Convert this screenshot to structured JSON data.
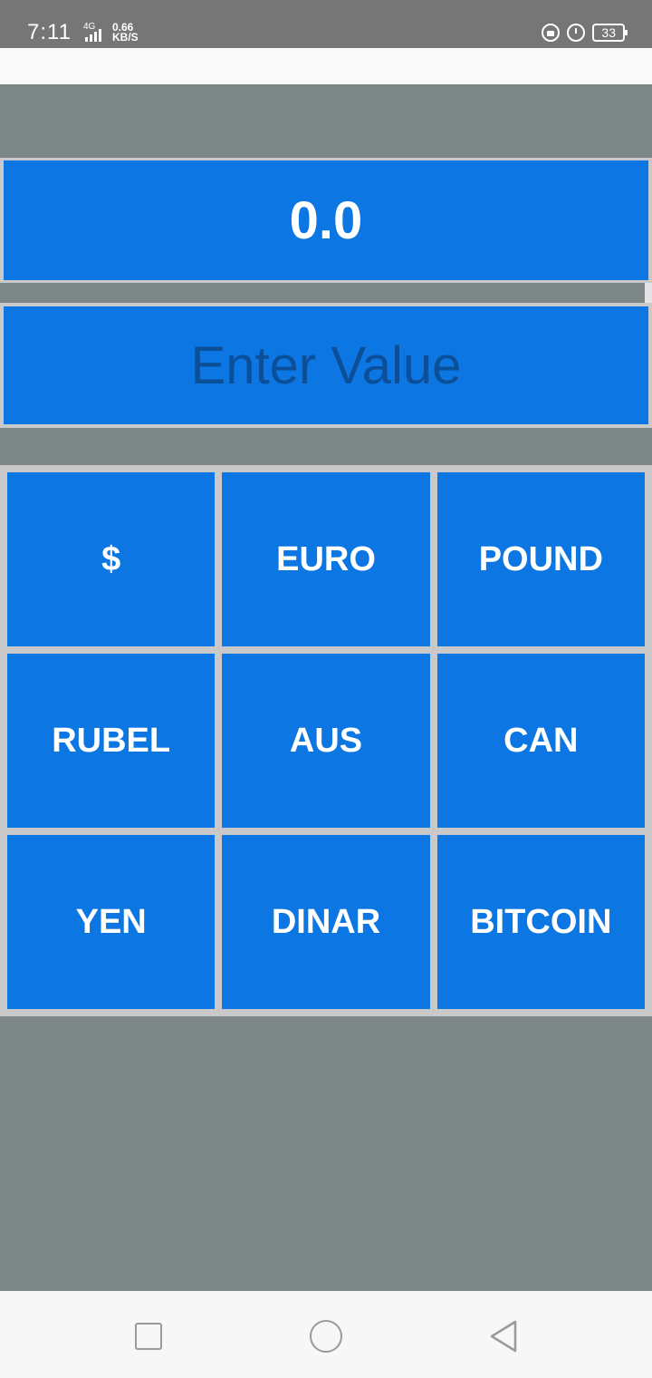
{
  "status_bar": {
    "time": "7:11",
    "network": "4G",
    "speed_value": "0.66",
    "speed_unit": "KB/S",
    "battery": "33",
    "icons": [
      "rotation-lock-icon",
      "alarm-icon",
      "battery-icon"
    ]
  },
  "result": {
    "value": "0.0"
  },
  "input": {
    "placeholder": "Enter Value",
    "value": ""
  },
  "currencies": [
    {
      "label": "$"
    },
    {
      "label": "EURO"
    },
    {
      "label": "POUND"
    },
    {
      "label": "RUBEL"
    },
    {
      "label": "AUS"
    },
    {
      "label": "CAN"
    },
    {
      "label": "YEN"
    },
    {
      "label": "DINAR"
    },
    {
      "label": "BITCOIN"
    }
  ],
  "nav": {
    "icons": [
      "recent-apps-icon",
      "home-icon",
      "back-icon"
    ]
  },
  "colors": {
    "accent": "#0c77e2",
    "background": "#7d8788",
    "border": "#c9c9c9",
    "placeholder_text": "#0b4f99"
  }
}
